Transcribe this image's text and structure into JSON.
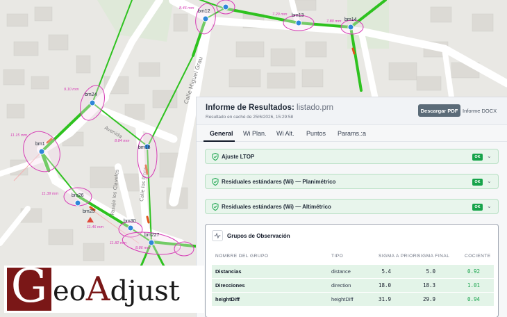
{
  "map": {
    "stations": [
      {
        "id": "bm12",
        "label": "bm12"
      },
      {
        "id": "bm13",
        "label": "bm13"
      },
      {
        "id": "bm14",
        "label": "bm14"
      },
      {
        "id": "bm24",
        "label": "bm24"
      },
      {
        "id": "bm1",
        "label": "bm1"
      },
      {
        "id": "bm18",
        "label": "bm18"
      },
      {
        "id": "bm26",
        "label": "bm26"
      },
      {
        "id": "bm25",
        "label": "bm25"
      },
      {
        "id": "bm30",
        "label": "bm30"
      },
      {
        "id": "bm227",
        "label": "bm227"
      }
    ],
    "ellipse_labels": {
      "bm12": "8.46 mm",
      "bm13": "7.20 mm",
      "bm14": "7.80 mm",
      "bm24": "9.10 mm",
      "bm1": "11.15 mm",
      "bm18": "8.84 mm",
      "bm26": "11.39 mm",
      "bm25": "11.46 mm",
      "bm227": "11.82 mm",
      "bm30": "8.86 mm"
    },
    "streets": {
      "calle_miguel_grau": "Calle Miguel Grau",
      "avenida": "Avenida",
      "pasaje_los_claveles": "Pasaje los Claveles",
      "calle_los_pinos": "Calle los Pinos"
    },
    "colors": {
      "observation": "#2ec21f",
      "ellipse": "#d63bb5",
      "station": "#2f86d8",
      "accent_error": "#e0541c"
    }
  },
  "panel": {
    "title": "Informe de Resultados:",
    "file": "listado.prn",
    "cache_note": "Resultado en caché de 25/6/2026, 15:29:58",
    "download_pdf": "Descargar PDF",
    "docx": "Informe DOCX",
    "tabs": [
      "General",
      "Wi Plan.",
      "Wi Alt.",
      "Puntos",
      "Params.:a"
    ],
    "sections": [
      {
        "label": "Ajuste LTOP",
        "badge": "OK"
      },
      {
        "label": "Residuales estándares (Wi) — Planimétrico",
        "badge": "OK"
      },
      {
        "label": "Residuales estándares (Wi) — Altimétrico",
        "badge": "OK"
      }
    ],
    "groups": {
      "title": "Grupos de Observación",
      "headers": [
        "NOMBRE DEL GRUPO",
        "TIPO",
        "SIGMA A PRIORI",
        "SIGMA FINAL",
        "COCIENTE"
      ],
      "rows": [
        {
          "name": "Distancias",
          "tipo": "distance",
          "sigma_a_priori": "5.4",
          "sigma_final": "5.0",
          "cociente": "0.92"
        },
        {
          "name": "Direcciones",
          "tipo": "direction",
          "sigma_a_priori": "18.0",
          "sigma_final": "18.3",
          "cociente": "1.01"
        },
        {
          "name": "heightDiff",
          "tipo": "heightDiff",
          "sigma_a_priori": "31.9",
          "sigma_final": "29.9",
          "cociente": "0.94"
        }
      ]
    },
    "colors": {
      "ok_green": "#16a34a",
      "row_bg": "#e3f4e8",
      "button": "#5b6b78"
    }
  },
  "logo": {
    "initial": "G",
    "rest_1": "eo",
    "cap": "A",
    "rest_2": "djust",
    "colors": {
      "brand": "#7a1717"
    }
  }
}
